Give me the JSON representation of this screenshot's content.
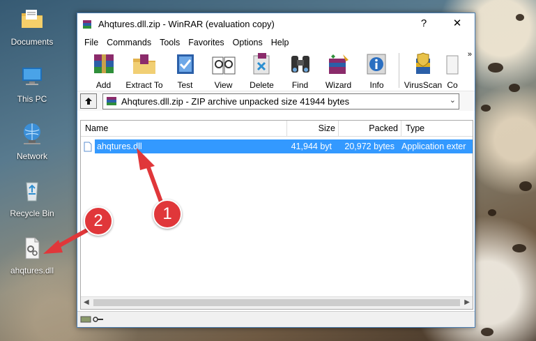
{
  "desktop": {
    "icons": [
      {
        "label": "Documents"
      },
      {
        "label": "This PC"
      },
      {
        "label": "Network"
      },
      {
        "label": "Recycle Bin"
      },
      {
        "label": "ahqtures.dll"
      }
    ]
  },
  "window": {
    "title": "Ahqtures.dll.zip - WinRAR (evaluation copy)",
    "help_btn": "?",
    "close_btn": "✕"
  },
  "menu": [
    "File",
    "Commands",
    "Tools",
    "Favorites",
    "Options",
    "Help"
  ],
  "toolbar": {
    "items": [
      "Add",
      "Extract To",
      "Test",
      "View",
      "Delete",
      "Find",
      "Wizard",
      "Info",
      "VirusScan",
      "Co"
    ],
    "more": "»"
  },
  "address": {
    "text": "Ahqtures.dll.zip - ZIP archive unpacked size 41944 bytes"
  },
  "columns": [
    "Name",
    "Size",
    "Packed",
    "Type"
  ],
  "files": [
    {
      "name": "ahqtures.dll",
      "size": "41,944 byt",
      "packed": "20,972 bytes",
      "type": "Application exter"
    }
  ],
  "annotations": [
    "1",
    "2"
  ],
  "colors": {
    "selection": "#3399ff",
    "badge": "#e0373a",
    "arrow": "#e0373a"
  }
}
